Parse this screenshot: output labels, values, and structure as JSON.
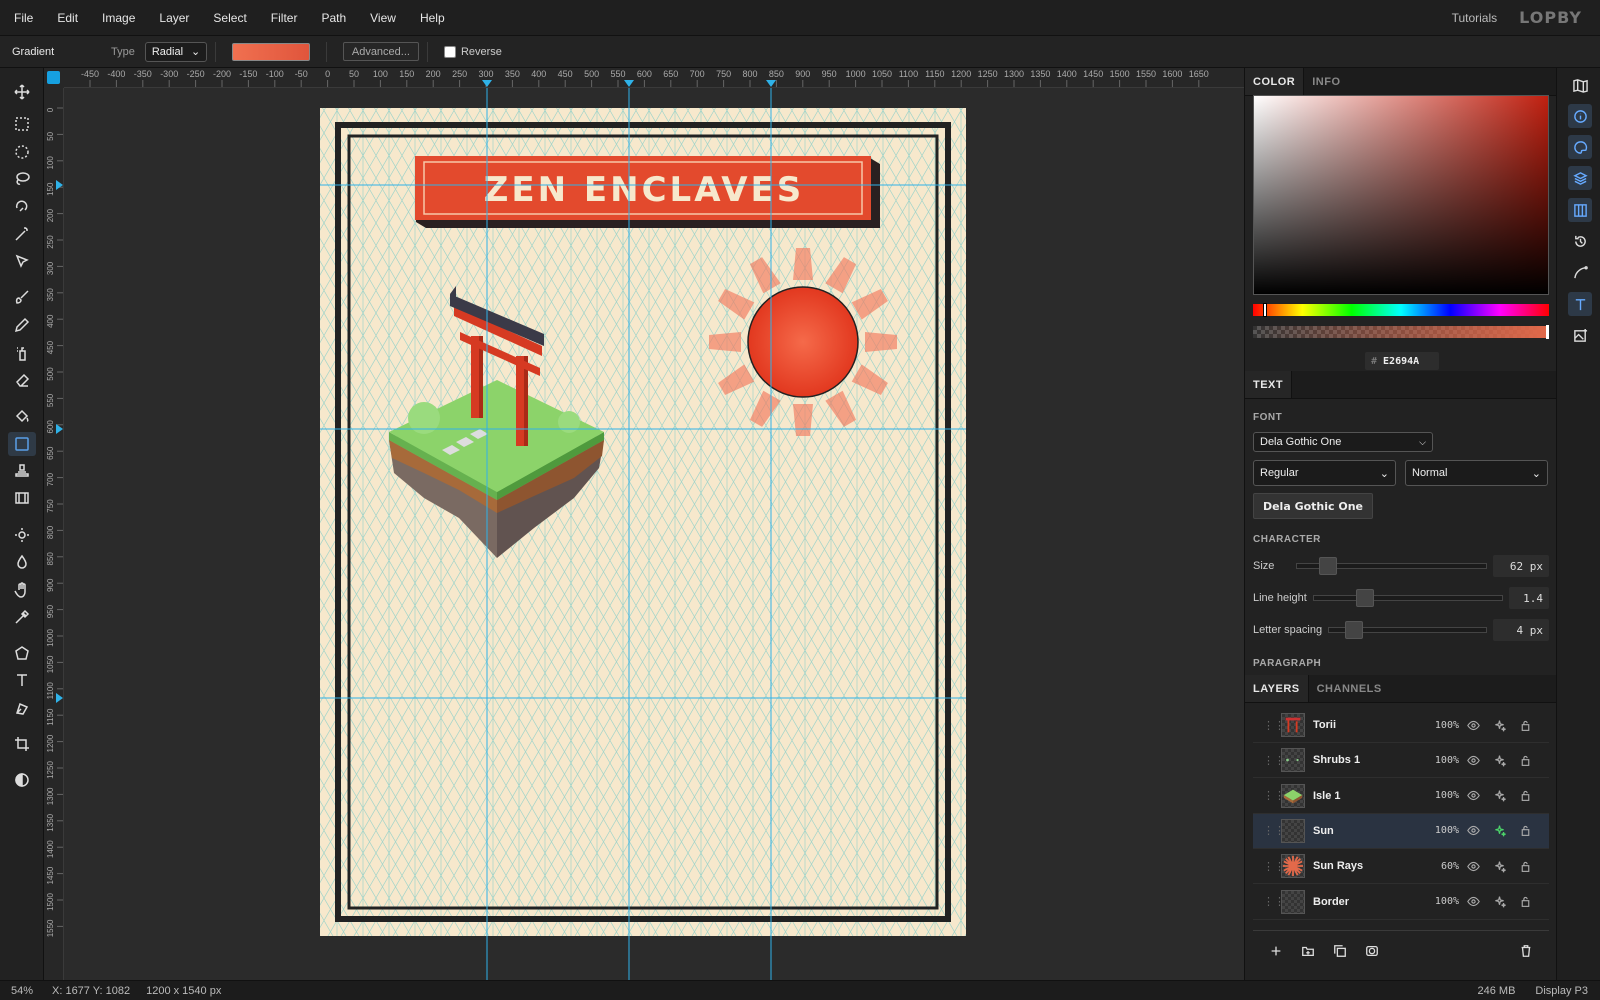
{
  "menu": [
    "File",
    "Edit",
    "Image",
    "Layer",
    "Select",
    "Filter",
    "Path",
    "View",
    "Help"
  ],
  "header": {
    "tutorials": "Tutorials",
    "logo": "LOPBY"
  },
  "options": {
    "tool": "Gradient",
    "type_label": "Type",
    "type_value": "Radial",
    "advanced": "Advanced...",
    "reverse": "Reverse",
    "gradient_color": "#E2694A"
  },
  "ruler_h": [
    "-450",
    "-400",
    "-350",
    "-300",
    "-250",
    "-200",
    "-150",
    "-100",
    "-50",
    "0",
    "50",
    "100",
    "150",
    "200",
    "250",
    "300",
    "350",
    "400",
    "450",
    "500",
    "550",
    "600",
    "650",
    "700",
    "750",
    "800",
    "850",
    "900",
    "950",
    "1000",
    "1050",
    "1100",
    "1150",
    "1200",
    "1250",
    "1300",
    "1350",
    "1400",
    "1450",
    "1500",
    "1550",
    "1600",
    "1650"
  ],
  "ruler_v": [
    "0",
    "50",
    "100",
    "150",
    "200",
    "250",
    "300",
    "350",
    "400",
    "450",
    "500",
    "550",
    "600",
    "650",
    "700",
    "750",
    "800",
    "850",
    "900",
    "950",
    "1000",
    "1050",
    "1100",
    "1150",
    "1200",
    "1250",
    "1300",
    "1350",
    "1400",
    "1450",
    "1500",
    "1550"
  ],
  "poster": {
    "title": "ZEN ENCLAVES"
  },
  "color_panel": {
    "tab_color": "COLOR",
    "tab_info": "INFO",
    "hash": "#",
    "hex": "E2694A"
  },
  "text_panel": {
    "tab": "TEXT",
    "font_label": "FONT",
    "font_family": "Dela Gothic One",
    "weight": "Regular",
    "style": "Normal",
    "preview": "Dela Gothic One",
    "character_label": "CHARACTER",
    "paragraph_label": "PARAGRAPH",
    "size_label": "Size",
    "size_value": "62 px",
    "line_height_label": "Line height",
    "line_height_value": "1.4",
    "letter_spacing_label": "Letter spacing",
    "letter_spacing_value": "4 px"
  },
  "layers_panel": {
    "tab_layers": "LAYERS",
    "tab_channels": "CHANNELS",
    "layers": [
      {
        "name": "Torii",
        "opacity": "100%"
      },
      {
        "name": "Shrubs 1",
        "opacity": "100%"
      },
      {
        "name": "Isle 1",
        "opacity": "100%"
      },
      {
        "name": "Sun",
        "opacity": "100%",
        "selected": true
      },
      {
        "name": "Sun Rays",
        "opacity": "60%"
      },
      {
        "name": "Border",
        "opacity": "100%"
      }
    ]
  },
  "status": {
    "zoom": "54%",
    "coords": "X: 1677 Y: 1082",
    "dims": "1200 x 1540 px",
    "memory": "246 MB",
    "display": "Display P3"
  }
}
